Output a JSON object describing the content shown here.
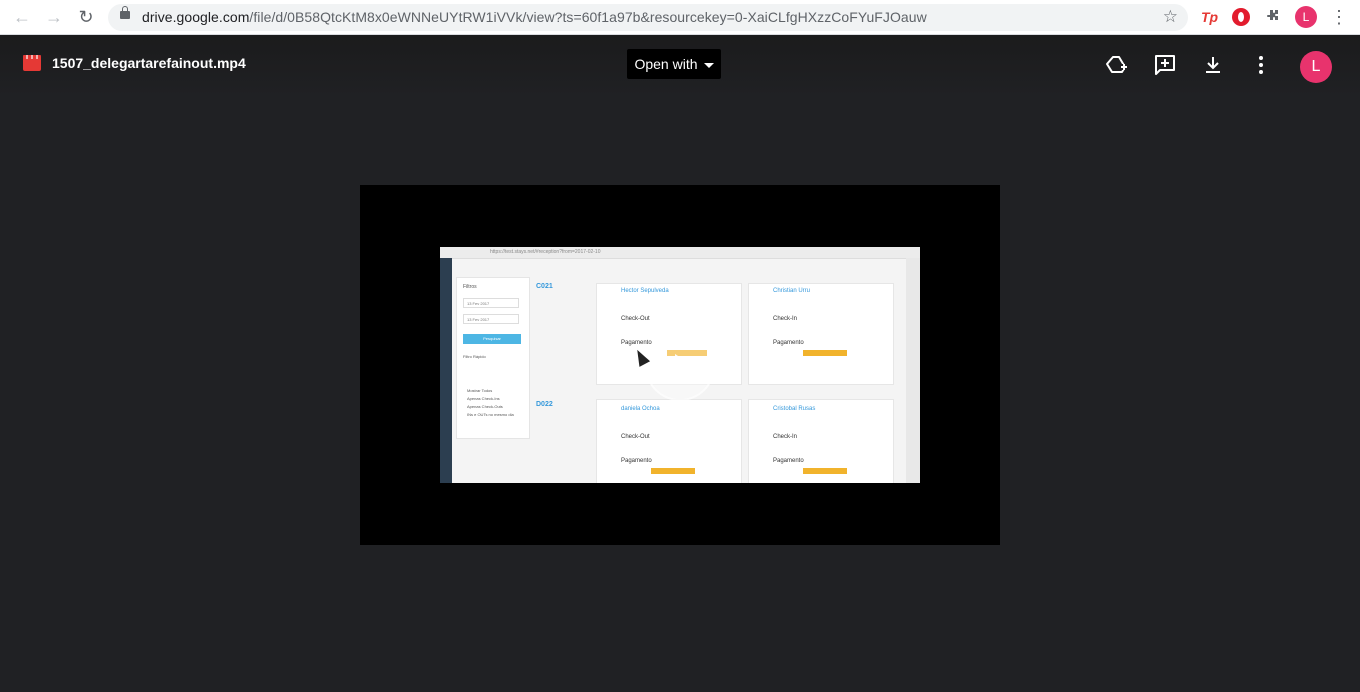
{
  "browser": {
    "url_host": "drive.google.com",
    "url_path": "/file/d/0B58QtcKtM8x0eWNNeUYtRW1iVVk/view?ts=60f1a97b&resourcekey=0-XaiCLfgHXzzCoFYuFJOauw",
    "back_icon": "arrow-left-icon",
    "forward_icon": "arrow-right-icon",
    "reload_icon": "reload-icon",
    "star_icon": "star-icon",
    "extensions": [
      "Tp",
      "opera-icon",
      "puzzle-icon"
    ],
    "profile_initial": "L",
    "profile_color": "#e8336d"
  },
  "viewer": {
    "file_name": "1507_delegartarefainout.mp4",
    "open_with_label": "Open with",
    "actions": [
      "add-to-drive-icon",
      "add-comment-icon",
      "download-icon",
      "more-vert-icon"
    ],
    "avatar_initial": "L",
    "avatar_color": "#e8336d",
    "background_color": "#202124"
  },
  "video": {
    "play_icon": "play-icon",
    "content_snippet": {
      "url": "https://test.stays.net/#reception?from=2017-02-10",
      "room1": "C021",
      "room2": "D022",
      "guest1": "Hector Sepulveda",
      "guest2": "Christian Urru",
      "guest3": "daniela Ochoa",
      "guest4": "Cristobal Rusas",
      "checkout_label": "Check-Out",
      "checkin_label": "Check-In",
      "payment_label": "Pagamento",
      "filter_label": "Filtros",
      "date1": "13 Fev 2017",
      "date2": "13 Fev 2017",
      "search_button": "Pesquisar",
      "quick_filter": "Filtro Rápido",
      "opt1": "Mostrar Todos",
      "opt2": "Apenas Check-Ins",
      "opt3": "Apenas Check-Outs",
      "opt4": "INs e OUTs no mesmo dia"
    }
  }
}
